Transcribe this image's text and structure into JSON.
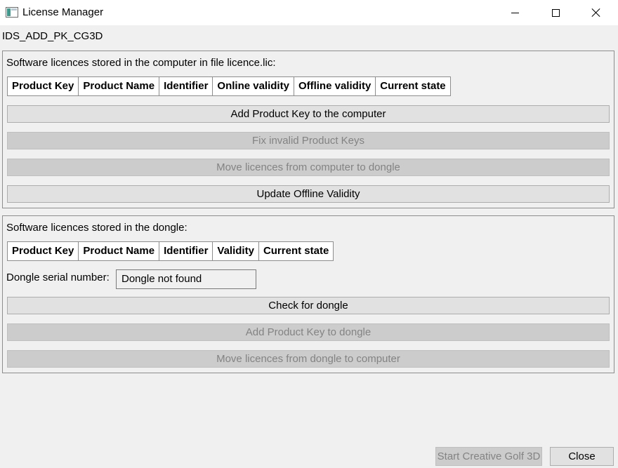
{
  "window": {
    "title": "License Manager",
    "icon": "app-window-icon",
    "controls": [
      "minimize-icon",
      "maximize-icon",
      "close-icon"
    ]
  },
  "module_id": "IDS_ADD_PK_CG3D",
  "computer_section": {
    "title": "Software licences stored in the computer in file licence.lic:",
    "columns": [
      "Product Key",
      "Product Name",
      "Identifier",
      "Online validity",
      "Offline validity",
      "Current state"
    ],
    "buttons": {
      "add_key": {
        "label": "Add Product Key to the computer",
        "enabled": true
      },
      "fix_invalid": {
        "label": "Fix invalid Product Keys",
        "enabled": false
      },
      "move_to_dongle": {
        "label": "Move licences from computer to dongle",
        "enabled": false
      },
      "update_offline": {
        "label": "Update Offline Validity",
        "enabled": true
      }
    }
  },
  "dongle_section": {
    "title": "Software licences stored in the dongle:",
    "columns": [
      "Product Key",
      "Product Name",
      "Identifier",
      "Validity",
      "Current state"
    ],
    "serial_label": "Dongle serial number:",
    "serial_value": "Dongle not found",
    "buttons": {
      "check": {
        "label": "Check for dongle",
        "enabled": true
      },
      "add_key": {
        "label": "Add Product Key to dongle",
        "enabled": false
      },
      "move_to_computer": {
        "label": "Move licences from dongle to computer",
        "enabled": false
      }
    }
  },
  "footer": {
    "start": {
      "label": "Start Creative Golf 3D",
      "enabled": false
    },
    "close": {
      "label": "Close",
      "enabled": true
    }
  }
}
